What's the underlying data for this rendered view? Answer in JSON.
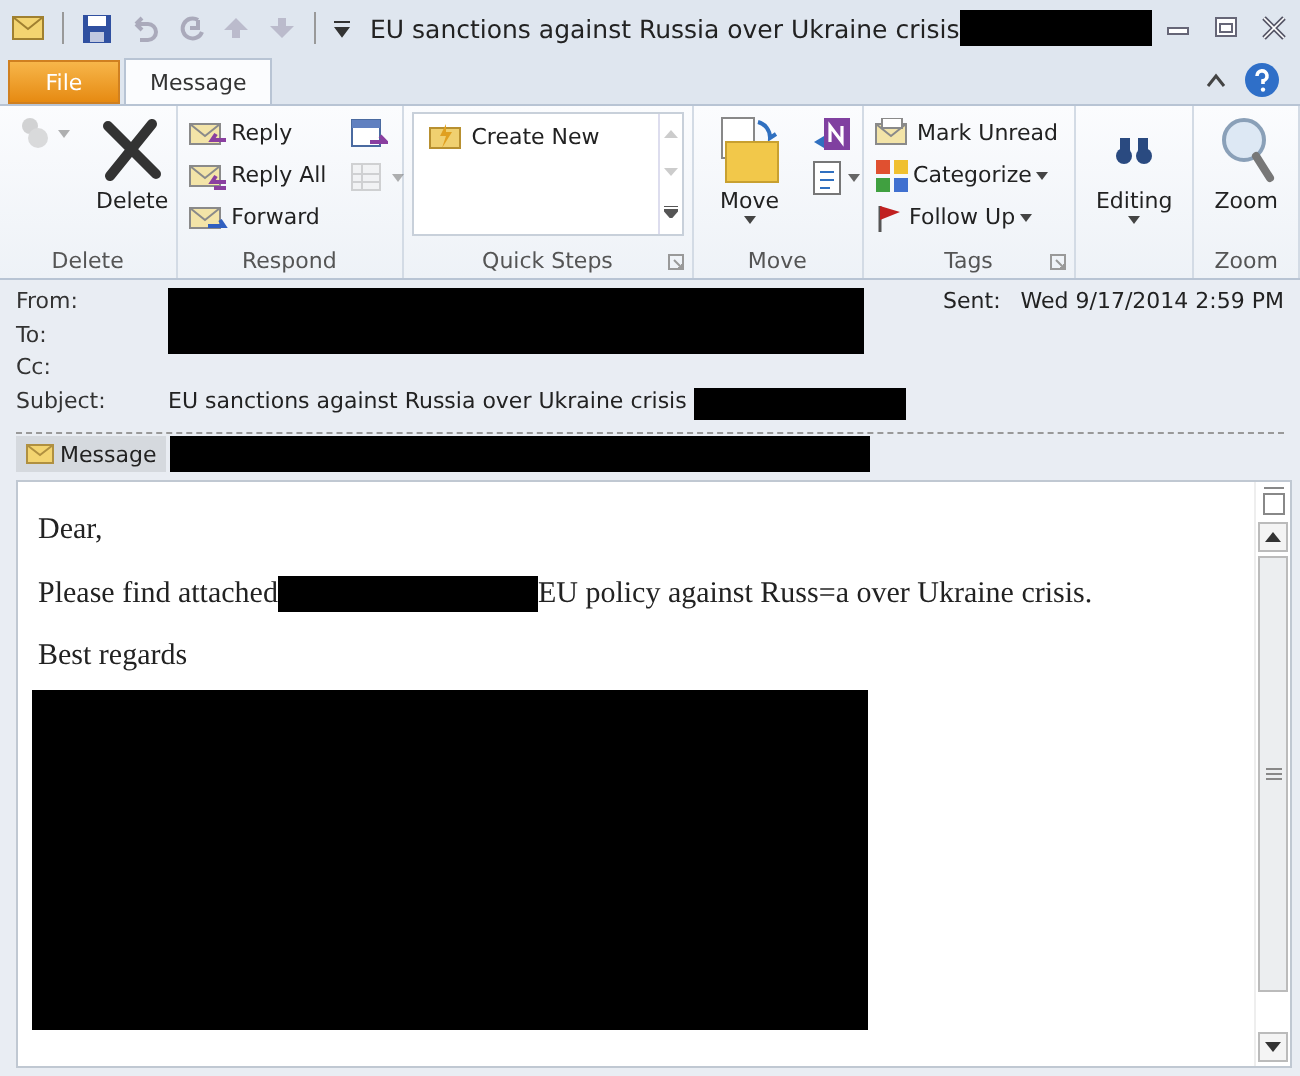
{
  "window": {
    "title": "EU sanctions against Russia over Ukraine crisis",
    "title_redacted": true
  },
  "tabs": [
    {
      "label": "File",
      "kind": "file",
      "selected": false
    },
    {
      "label": "Message",
      "kind": "tab",
      "selected": true
    }
  ],
  "ribbon": [
    {
      "label": "Delete",
      "items": [
        {
          "kind": "iconbtn",
          "dropdown": true,
          "disabled": true
        },
        {
          "kind": "large",
          "label": "Delete"
        }
      ]
    },
    {
      "label": "Respond",
      "items": [
        {
          "kind": "small",
          "label": "Reply"
        },
        {
          "kind": "small",
          "label": "Reply All"
        },
        {
          "kind": "small",
          "label": "Forward"
        },
        {
          "kind": "iconbtn",
          "disabled": false
        },
        {
          "kind": "iconbtn",
          "dropdown": true,
          "disabled": true
        }
      ]
    },
    {
      "label": "Quick Steps",
      "launcher": true,
      "items": [
        {
          "kind": "gallery",
          "label": "Create New"
        }
      ]
    },
    {
      "label": "Move",
      "items": [
        {
          "kind": "large",
          "label": "Move",
          "dropdown": true
        },
        {
          "kind": "iconbtn",
          "disabled": false
        },
        {
          "kind": "iconbtn",
          "dropdown": true,
          "disabled": false
        }
      ]
    },
    {
      "label": "Tags",
      "launcher": true,
      "items": [
        {
          "kind": "small",
          "label": "Mark Unread"
        },
        {
          "kind": "small",
          "label": "Categorize",
          "dropdown": true
        },
        {
          "kind": "small",
          "label": "Follow Up",
          "dropdown": true
        }
      ]
    },
    {
      "items": [
        {
          "kind": "large",
          "label": "Editing",
          "dropdown": true
        }
      ]
    },
    {
      "label": "Zoom",
      "items": [
        {
          "kind": "large",
          "label": "Zoom"
        }
      ]
    }
  ],
  "header": {
    "fields": [
      {
        "label": "From:",
        "redacted": true
      },
      {
        "label": "To:",
        "redacted": true
      },
      {
        "label": "Cc:"
      },
      {
        "label": "Subject:",
        "value": "EU sanctions against Russia over Ukraine crisis",
        "redacted": true
      }
    ],
    "sent": {
      "label": "Sent:",
      "value": "Wed 9/17/2014 2:59 PM"
    },
    "message_tab": {
      "label": "Message",
      "selected": true,
      "redacted": true
    }
  },
  "body": {
    "paragraphs": [
      {
        "parts": [
          {
            "kind": "text",
            "text": "Dear,"
          }
        ]
      },
      {
        "parts": [
          {
            "kind": "text",
            "text": "Please find attached"
          },
          {
            "kind": "redacted"
          },
          {
            "kind": "text",
            "text": "EU policy against Russ=a over Ukraine crisis."
          }
        ]
      },
      {
        "parts": [
          {
            "kind": "text",
            "text": "Best regards"
          }
        ]
      }
    ],
    "signature_redacted": true
  }
}
